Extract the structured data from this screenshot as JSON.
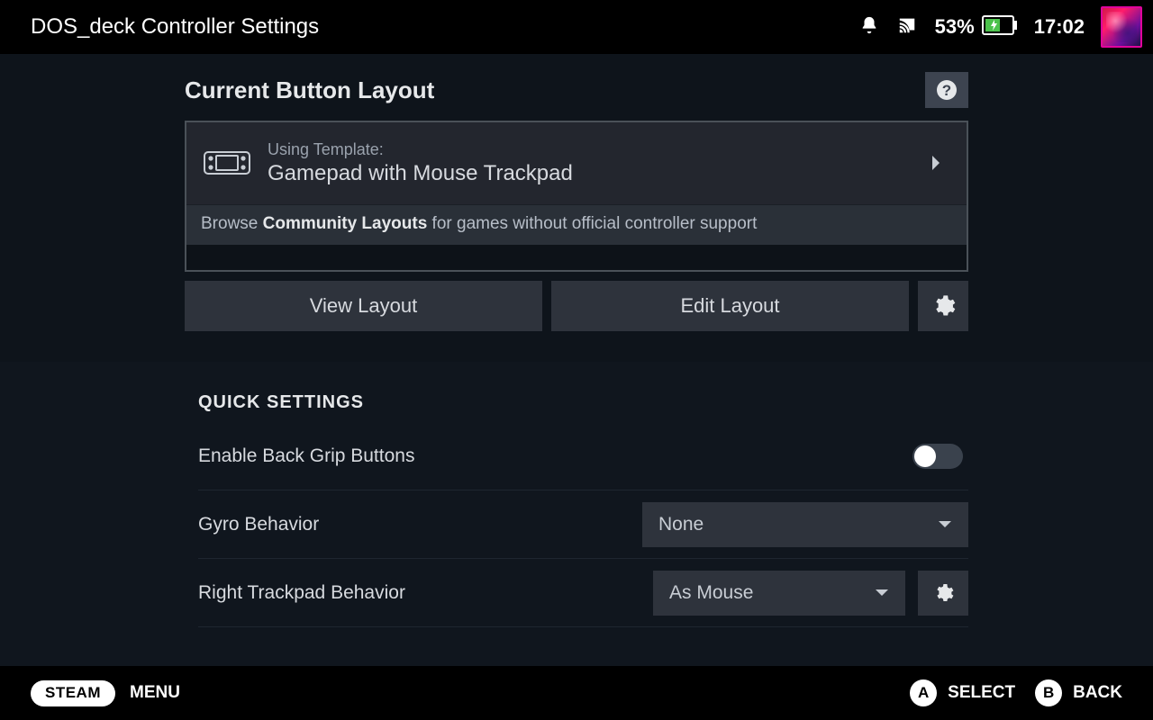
{
  "header": {
    "title": "DOS_deck Controller Settings",
    "battery_pct": "53%",
    "time": "17:02"
  },
  "layout": {
    "section_title": "Current Button Layout",
    "template_label": "Using Template:",
    "template_name": "Gamepad with Mouse Trackpad",
    "community_pre": "Browse ",
    "community_bold": "Community Layouts",
    "community_post": " for games without official controller support",
    "view_btn": "View Layout",
    "edit_btn": "Edit Layout"
  },
  "quick": {
    "title": "QUICK SETTINGS",
    "rows": [
      {
        "label": "Enable Back Grip Buttons"
      },
      {
        "label": "Gyro Behavior",
        "value": "None"
      },
      {
        "label": "Right Trackpad Behavior",
        "value": "As Mouse"
      }
    ]
  },
  "footer": {
    "steam": "STEAM",
    "menu": "MENU",
    "select": "SELECT",
    "back": "BACK",
    "a": "A",
    "b": "B"
  }
}
